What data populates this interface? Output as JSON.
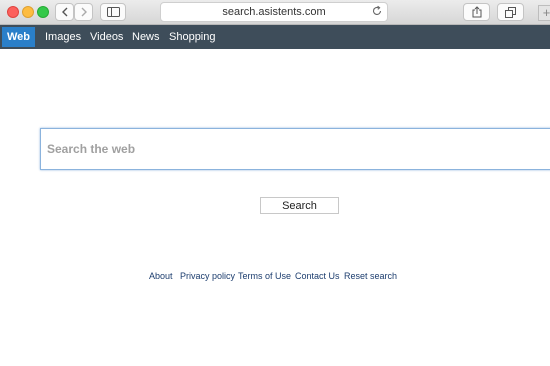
{
  "browser": {
    "url": "search.asistents.com",
    "new_tab_label": "+"
  },
  "nav": {
    "items": [
      {
        "label": "Web",
        "active": true
      },
      {
        "label": "Images",
        "active": false
      },
      {
        "label": "Videos",
        "active": false
      },
      {
        "label": "News",
        "active": false
      },
      {
        "label": "Shopping",
        "active": false
      }
    ]
  },
  "search": {
    "placeholder": "Search the web",
    "value": "",
    "button_label": "Search"
  },
  "footer": {
    "links": [
      "About",
      "Privacy policy",
      "Terms of Use",
      "Contact Us",
      "Reset search"
    ]
  },
  "colors": {
    "nav_background": "#3e4d5a",
    "nav_active": "#2a7fc9",
    "footer_link": "#1c3d6e",
    "search_focus_border": "#8bb3dd"
  }
}
